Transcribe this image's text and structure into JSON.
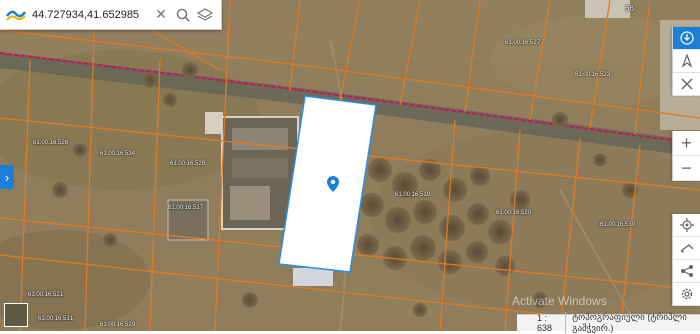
{
  "search": {
    "value": "44.727934,41.652985"
  },
  "parcel_labels": [
    "61.00.16.527",
    "61.00.16.523",
    "61.00.16.526",
    "61.00.16.524",
    "61.00.16.528",
    "61.00.16.519",
    "61.00.16.520",
    "61.00.16.530",
    "61.00.16.531",
    "61.00.16.529",
    "61.00.16.521",
    "61.00.16.517"
  ],
  "corner_label": "66",
  "status": {
    "scale": "1 : 638",
    "source": "ტოპოგრაფიული (ტრიპლი გამჭვირ.)"
  },
  "watermark": "Activate Windows",
  "sidebar_right": {
    "tools": [
      "download-icon",
      "location-pin-icon",
      "tools-icon"
    ],
    "zoom_in": "+",
    "zoom_out": "−",
    "bottom_tools": [
      "locate-icon",
      "measure-icon",
      "share-icon",
      "settings-icon"
    ]
  },
  "colors": {
    "parcel_line": "#e07a23",
    "road_line": "#c2185b",
    "selection_fill": "#ffffff",
    "selection_border": "#2a8fe0",
    "accent": "#1b7fd8"
  }
}
